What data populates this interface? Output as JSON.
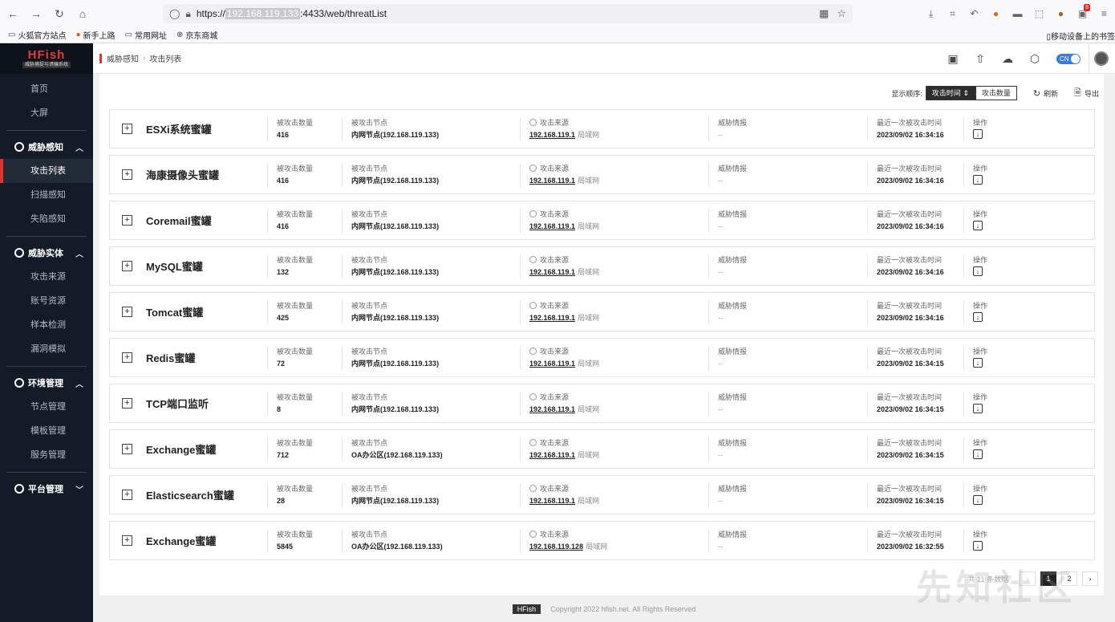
{
  "browser": {
    "url_prefix": "https://",
    "url_host": "192.168.119.133",
    "url_suffix": ":4433/web/threatList",
    "badge": "8"
  },
  "bookmarks": [
    {
      "label": "火狐官方站点"
    },
    {
      "label": "新手上路"
    },
    {
      "label": "常用网址"
    },
    {
      "label": "京东商城"
    }
  ],
  "bookmarks_right": "移动设备上的书签",
  "logo": {
    "main": "HFish",
    "sub": "威胁捕捉与诱骗系统"
  },
  "sidebar": {
    "top_items": [
      "首页",
      "大屏"
    ],
    "groups": [
      {
        "label": "威胁感知",
        "items": [
          "攻击列表",
          "扫描感知",
          "失陷感知"
        ]
      },
      {
        "label": "威胁实体",
        "items": [
          "攻击来源",
          "账号资源",
          "样本检测",
          "漏洞模拟"
        ]
      },
      {
        "label": "环境管理",
        "items": [
          "节点管理",
          "模板管理",
          "服务管理"
        ]
      },
      {
        "label": "平台管理",
        "items": []
      }
    ]
  },
  "breadcrumb": {
    "parent": "威胁感知",
    "current": "攻击列表"
  },
  "header": {
    "lang": "CN"
  },
  "toolbar": {
    "sort_label": "显示顺序:",
    "sort_time": "攻击时间",
    "sort_count": "攻击数量",
    "refresh": "刷新",
    "export": "导出"
  },
  "labels": {
    "count": "被攻击数量",
    "node": "被攻击节点",
    "source": "攻击来源",
    "intel": "威胁情报",
    "last_time": "最近一次被攻击时间",
    "ops": "操作",
    "lan": "局域网",
    "dash": "--"
  },
  "rows": [
    {
      "name": "ESXi系统蜜罐",
      "count": "416",
      "node": "内网节点(192.168.119.133)",
      "source": "192.168.119.1",
      "time": "2023/09/02 16:34:16"
    },
    {
      "name": "海康摄像头蜜罐",
      "count": "416",
      "node": "内网节点(192.168.119.133)",
      "source": "192.168.119.1",
      "time": "2023/09/02 16:34:16"
    },
    {
      "name": "Coremail蜜罐",
      "count": "416",
      "node": "内网节点(192.168.119.133)",
      "source": "192.168.119.1",
      "time": "2023/09/02 16:34:16"
    },
    {
      "name": "MySQL蜜罐",
      "count": "132",
      "node": "内网节点(192.168.119.133)",
      "source": "192.168.119.1",
      "time": "2023/09/02 16:34:16"
    },
    {
      "name": "Tomcat蜜罐",
      "count": "425",
      "node": "内网节点(192.168.119.133)",
      "source": "192.168.119.1",
      "time": "2023/09/02 16:34:16"
    },
    {
      "name": "Redis蜜罐",
      "count": "72",
      "node": "内网节点(192.168.119.133)",
      "source": "192.168.119.1",
      "time": "2023/09/02 16:34:15"
    },
    {
      "name": "TCP端口监听",
      "count": "8",
      "node": "内网节点(192.168.119.133)",
      "source": "192.168.119.1",
      "time": "2023/09/02 16:34:15"
    },
    {
      "name": "Exchange蜜罐",
      "count": "712",
      "node": "OA办公区(192.168.119.133)",
      "source": "192.168.119.1",
      "time": "2023/09/02 16:34:15"
    },
    {
      "name": "Elasticsearch蜜罐",
      "count": "28",
      "node": "内网节点(192.168.119.133)",
      "source": "192.168.119.1",
      "time": "2023/09/02 16:34:15"
    },
    {
      "name": "Exchange蜜罐",
      "count": "5845",
      "node": "OA办公区(192.168.119.133)",
      "source": "192.168.119.128",
      "time": "2023/09/02 16:32:55"
    }
  ],
  "pager": {
    "total": "共 11 条数据",
    "pages": [
      "1",
      "2"
    ],
    "prev": "‹",
    "next": "›"
  },
  "footer": {
    "logo": "HFish",
    "copyright": "Copyright 2022 hfish.net. All Rights Reserved"
  },
  "watermark": "先知社区"
}
